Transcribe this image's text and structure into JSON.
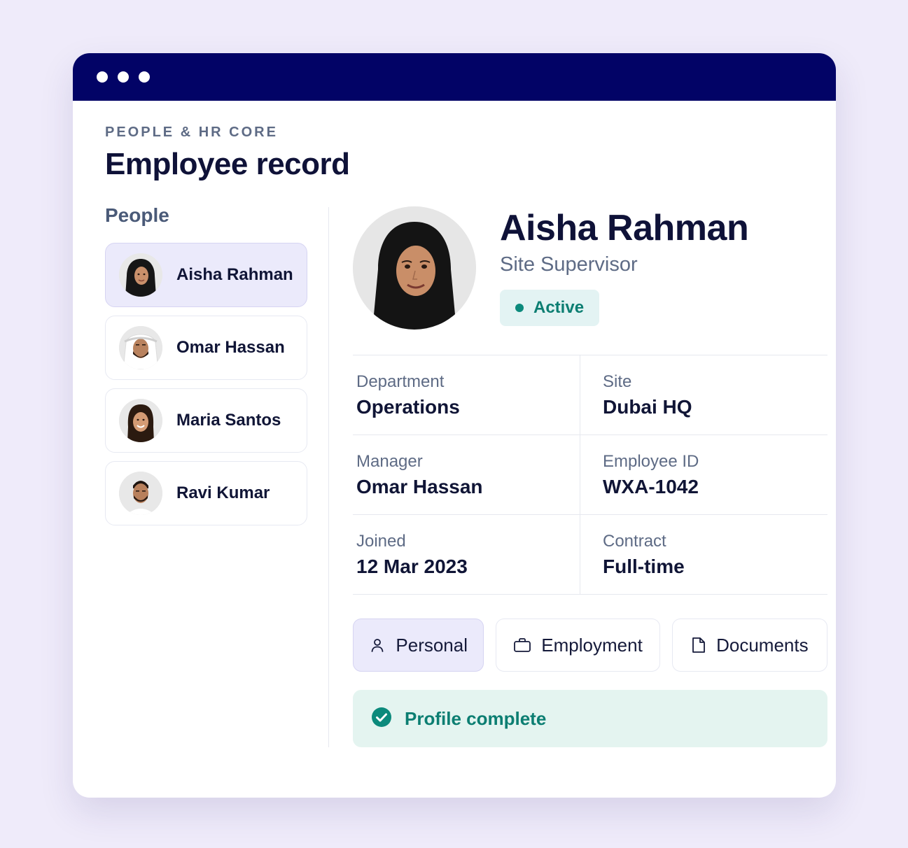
{
  "header": {
    "kicker": "PEOPLE & HR CORE",
    "title": "Employee record"
  },
  "sidebar": {
    "heading": "People",
    "people": [
      {
        "name": "Aisha Rahman",
        "selected": true
      },
      {
        "name": "Omar Hassan",
        "selected": false
      },
      {
        "name": "Maria Santos",
        "selected": false
      },
      {
        "name": "Ravi Kumar",
        "selected": false
      }
    ]
  },
  "profile": {
    "name": "Aisha Rahman",
    "role": "Site Supervisor",
    "status": "Active",
    "status_color": "#0c8a7c"
  },
  "details": {
    "department": {
      "label": "Department",
      "value": "Operations"
    },
    "site": {
      "label": "Site",
      "value": "Dubai HQ"
    },
    "manager": {
      "label": "Manager",
      "value": "Omar Hassan"
    },
    "employee_id": {
      "label": "Employee ID",
      "value": "WXA-1042"
    },
    "joined": {
      "label": "Joined",
      "value": "12 Mar 2023"
    },
    "contract": {
      "label": "Contract",
      "value": "Full-time"
    }
  },
  "tabs": [
    {
      "label": "Personal",
      "icon": "person-icon",
      "active": true
    },
    {
      "label": "Employment",
      "icon": "briefcase-icon",
      "active": false
    },
    {
      "label": "Documents",
      "icon": "document-icon",
      "active": false
    }
  ],
  "banner": {
    "text": "Profile complete",
    "icon": "check-circle-icon"
  },
  "colors": {
    "titlebar": "#020366",
    "accent_teal": "#0c8a7c",
    "selected_bg": "#ebeafb",
    "page_bg": "#efebfa"
  }
}
